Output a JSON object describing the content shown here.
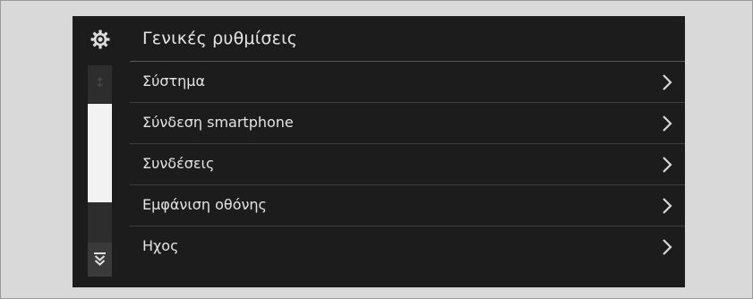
{
  "header": {
    "title": "Γενικές ρυθμίσεις",
    "icon": "gear-icon"
  },
  "menu": {
    "items": [
      {
        "label": "Σύστημα",
        "icon": "chevron-right-icon"
      },
      {
        "label": "Σύνδεση smartphone",
        "icon": "chevron-right-icon"
      },
      {
        "label": "Συνδέσεις",
        "icon": "chevron-right-icon"
      },
      {
        "label": "Εμφάνιση οθόνης",
        "icon": "chevron-right-icon"
      },
      {
        "label": "Ηχος",
        "icon": "chevron-right-icon"
      }
    ]
  },
  "scrollbar": {
    "up_icon": "scroll-up-icon",
    "down_icon": "scroll-down-icon"
  },
  "colors": {
    "screen_background": "#1c1c1c",
    "text": "#e4e4e4",
    "divider": "#3e3e3e",
    "scroll_thumb": "#f2f2f2"
  }
}
